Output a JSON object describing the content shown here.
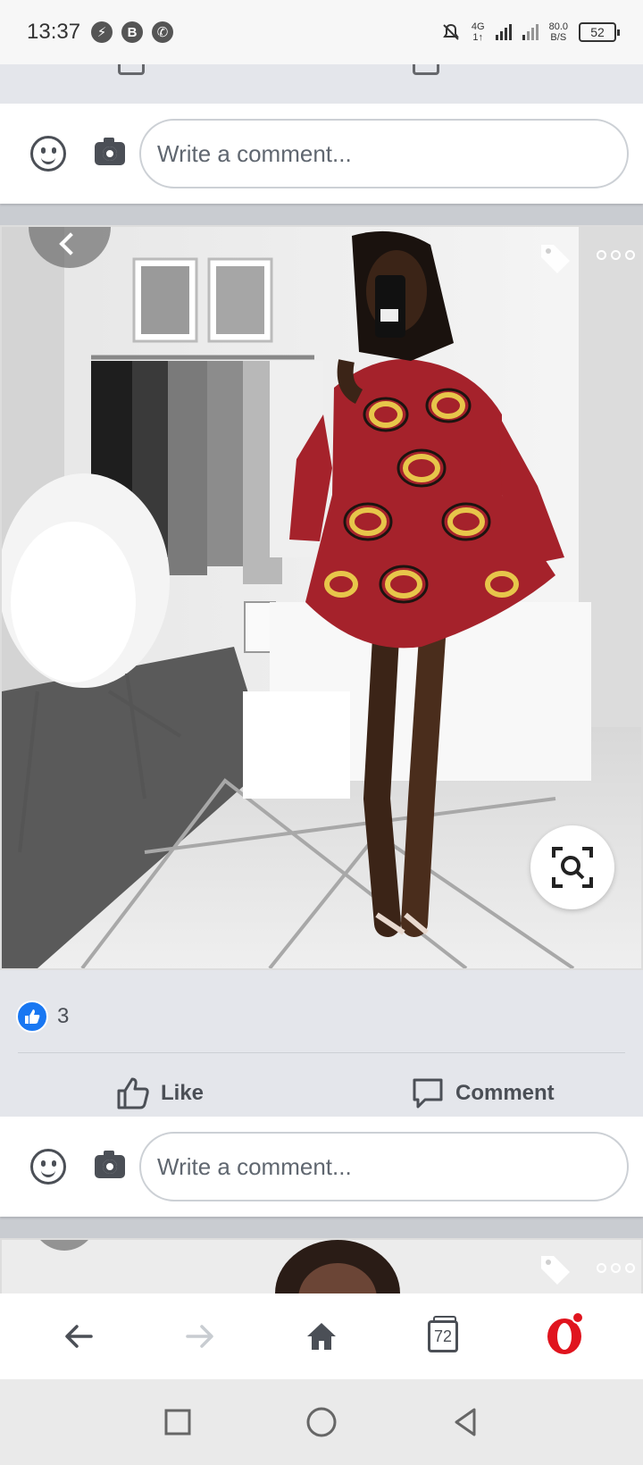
{
  "status_bar": {
    "time": "13:37",
    "app_badges": [
      "⚡",
      "B",
      "✆"
    ],
    "network_top": "4G",
    "network_bottom": "1↑",
    "speed_value": "80.0",
    "speed_unit": "B/S",
    "battery": "52"
  },
  "post": {
    "comment_placeholder": "Write a comment...",
    "reactions": {
      "like_count": "3"
    },
    "actions": {
      "like_label": "Like",
      "comment_label": "Comment"
    },
    "image": {
      "icons": [
        "tag-icon",
        "more-options-icon",
        "visual-search-icon"
      ]
    }
  },
  "browser_toolbar": {
    "tab_count": "72",
    "icons": [
      "back-arrow-icon",
      "forward-arrow-icon",
      "home-icon",
      "tabs-icon",
      "opera-menu-icon"
    ]
  },
  "system_nav": {
    "icons": [
      "recents-icon",
      "home-circle-icon",
      "back-triangle-icon"
    ]
  },
  "colors": {
    "facebook_blue": "#1877f2",
    "opera_red": "#e0141e",
    "dress_red": "#a5222b",
    "dress_gold": "#e7c64a"
  }
}
